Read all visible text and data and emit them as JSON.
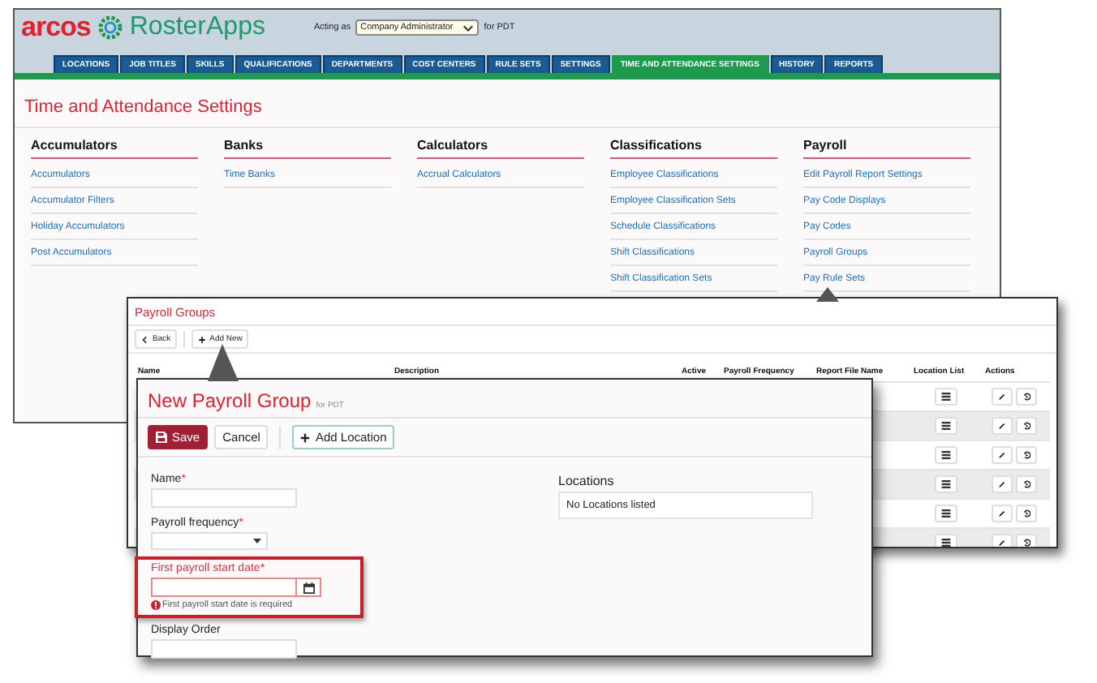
{
  "app": {
    "logo_word": "arcos",
    "logo_brand": "RosterApps",
    "acting_as_label": "Acting as",
    "acting_as_value": "Company Administrator",
    "acting_for": "for PDT"
  },
  "tabs": [
    {
      "label": "LOCATIONS",
      "selected": false
    },
    {
      "label": "JOB TITLES",
      "selected": false
    },
    {
      "label": "SKILLS",
      "selected": false
    },
    {
      "label": "QUALIFICATIONS",
      "selected": false
    },
    {
      "label": "DEPARTMENTS",
      "selected": false
    },
    {
      "label": "COST CENTERS",
      "selected": false
    },
    {
      "label": "RULE SETS",
      "selected": false
    },
    {
      "label": "SETTINGS",
      "selected": false
    },
    {
      "label": "TIME AND ATTENDANCE SETTINGS",
      "selected": true
    },
    {
      "label": "HISTORY",
      "selected": false
    },
    {
      "label": "REPORTS",
      "selected": false
    }
  ],
  "settings_page": {
    "title": "Time and Attendance Settings",
    "columns": [
      {
        "heading": "Accumulators",
        "links": [
          "Accumulators",
          "Accumulator Filters",
          "Holiday Accumulators",
          "Post Accumulators"
        ]
      },
      {
        "heading": "Banks",
        "links": [
          "Time Banks"
        ]
      },
      {
        "heading": "Calculators",
        "links": [
          "Accrual Calculators"
        ]
      },
      {
        "heading": "Classifications",
        "links": [
          "Employee Classifications",
          "Employee Classification Sets",
          "Schedule Classifications",
          "Shift Classifications",
          "Shift Classification Sets"
        ]
      },
      {
        "heading": "Payroll",
        "links": [
          "Edit Payroll Report Settings",
          "Pay Code Displays",
          "Pay Codes",
          "Payroll Groups",
          "Pay Rule Sets"
        ]
      }
    ]
  },
  "payroll_groups": {
    "title": "Payroll Groups",
    "buttons": [
      "Back",
      "Add New"
    ],
    "columns": [
      "Name",
      "Description",
      "Active",
      "Payroll Frequency",
      "Report File Name",
      "Location List",
      "Actions"
    ],
    "rows": [
      {
        "shaded": false
      },
      {
        "shaded": true
      },
      {
        "shaded": false
      },
      {
        "shaded": true
      },
      {
        "shaded": false
      },
      {
        "shaded": true
      }
    ]
  },
  "new_payroll_group": {
    "title": "New Payroll Group",
    "subtitle": "for PDT",
    "buttons": [
      {
        "label": "Save",
        "kind": "primary"
      },
      {
        "label": "Cancel",
        "kind": "plain"
      },
      {
        "label": "Add Location",
        "kind": "add"
      }
    ],
    "fields": [
      {
        "label": "Name",
        "required_mark": "*",
        "kind": "text",
        "invalid": false
      },
      {
        "label": "Payroll frequency",
        "required_mark": "*",
        "kind": "select",
        "invalid": false
      },
      {
        "label": "First payroll start date",
        "required_mark": "*",
        "kind": "date",
        "invalid": true,
        "error": "First payroll start date is required"
      },
      {
        "label": "Display Order",
        "kind": "text",
        "invalid": false
      }
    ],
    "locations": {
      "label": "Locations",
      "empty_text": "No Locations listed"
    }
  }
}
